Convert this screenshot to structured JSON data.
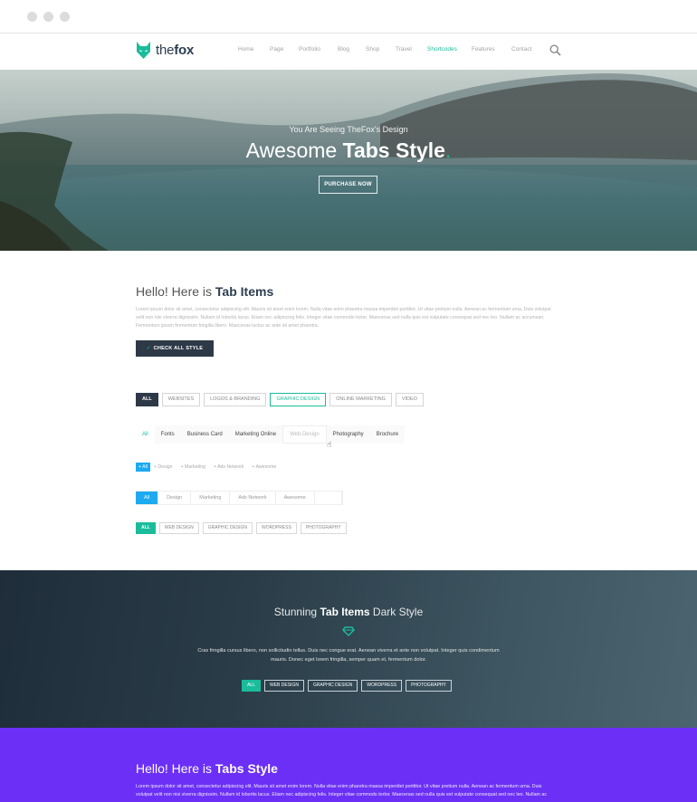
{
  "colors": {
    "accent": "#1abc9c",
    "dark": "#2d3947",
    "blue": "#1eaaf1",
    "purple": "#6b2ff5"
  },
  "header": {
    "logo_text_light": "the",
    "logo_text_bold": "fox",
    "nav": [
      "Home",
      "Page",
      "Portfolio",
      "Blog",
      "Shop",
      "Travel",
      "Shortcodes",
      "Features",
      "Contact"
    ],
    "active_nav": "Shortcodes",
    "search_icon": "search-icon"
  },
  "hero": {
    "subtitle": "You Are Seeing TheFox's Design",
    "title_light": "Awesome ",
    "title_bold": "Tabs Style",
    "title_dot": ".",
    "button": "PURCHASE NOW"
  },
  "tab_items": {
    "title_light": "Hello! Here is ",
    "title_bold": "Tab Items",
    "text": "Lorem ipsum dolor sit amet, consectetur adipiscing elit. Mauris sit amet enim lorem. Nulla vitae enim pharetra massa imperdiet porttitor. Ut vitae pretium nulla. Aenean ac fermentum urna. Duis volutpat velit non nisi viverra dignissim. Nullam id lobortis lacus. Etiam nec adipiscing felis. Integer vitae commodo tortor. Maecenas sed nulla quis est vulputate consequat sed nec leo. Nullam ac accumsan. Fermentum ipsum fermentum fringilla libero. Maecenas luctus ac ante sit amet pharetra.",
    "button": "CHECK ALL STYLE"
  },
  "tabs_style1": [
    "ALL",
    "WEBSITES",
    "LOGOS & BRANDING",
    "GRAPHIC DESIGN",
    "ONLINE MARKETING",
    "VIDEO"
  ],
  "tabs_style2": [
    "All",
    "Fonts",
    "Business Card",
    "Marketing Online",
    "Web Design",
    "Photography",
    "Brochure"
  ],
  "tabs_style3": [
    "+ All",
    "+ Design",
    "+ Marketing",
    "+ Ads Network",
    "+ Awesome"
  ],
  "tabs_style4": [
    "All",
    "Design",
    "Marketing",
    "Ads Network",
    "Awesome"
  ],
  "tabs_style5": [
    "ALL",
    "WEB DESIGN",
    "GRAPHIC DESIGN",
    "WORDPRESS",
    "PHOTOGRAPHY"
  ],
  "dark_section": {
    "title_light": "Stunning ",
    "title_bold": "Tab Items",
    "title_end": " Dark Style",
    "icon": "diamond-icon",
    "text": "Cras fringilla cursus libero, non sollicitudin tellus. Duis nec congue erat. Aenean viverra et ante non volutpat. Integer quis condimentum mauris. Donec eget lorem fringilla, semper quam et, fermentum dolor.",
    "tabs": [
      "ALL",
      "WEB DESIGN",
      "GRAPHIC DESIGN",
      "WORDPRESS",
      "PHOTOGRAPHY"
    ]
  },
  "purple_section": {
    "title_light": "Hello! Here is ",
    "title_bold": "Tabs Style",
    "text": "Lorem ipsum dolor sit amet, consectetur adipiscing elit. Mauris sit amet enim lorem. Nulla vitae enim pharetra massa imperdiet porttitor. Ut vitae pretium nulla. Aenean ac fermentum urna. Duis volutpat velit non nisi viverra dignissim. Nullam id lobortis lacus. Etiam nec adipiscing felis. Integer vitae commodo tortor. Maecenas sed nulla quis est vulputate consequat sed nec leo. Nullam ac"
  }
}
